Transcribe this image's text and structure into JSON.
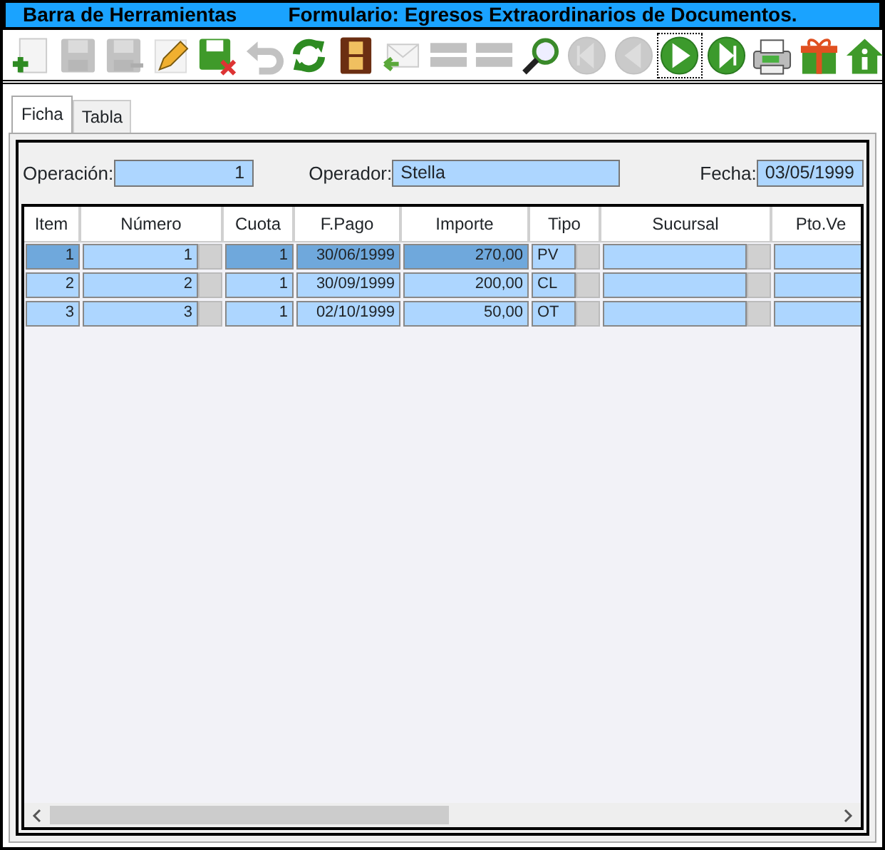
{
  "title_bar": {
    "left": "Barra de Herramientas",
    "right": "Formulario: Egresos Extraordinarios de Documentos."
  },
  "toolbar": [
    {
      "kind": "new",
      "disabled": false,
      "focused": false
    },
    {
      "kind": "save",
      "disabled": true,
      "focused": false
    },
    {
      "kind": "saveas",
      "disabled": true,
      "focused": false
    },
    {
      "kind": "edit",
      "disabled": false,
      "focused": false
    },
    {
      "kind": "cancel",
      "disabled": false,
      "focused": false
    },
    {
      "kind": "undo",
      "disabled": true,
      "focused": false
    },
    {
      "kind": "refresh",
      "disabled": false,
      "focused": false
    },
    {
      "kind": "film",
      "disabled": false,
      "focused": false
    },
    {
      "kind": "mail",
      "disabled": false,
      "focused": false
    },
    {
      "kind": "listadd",
      "disabled": true,
      "focused": false
    },
    {
      "kind": "list",
      "disabled": true,
      "focused": false
    },
    {
      "kind": "search",
      "disabled": false,
      "focused": false
    },
    {
      "kind": "first",
      "disabled": true,
      "focused": false
    },
    {
      "kind": "prev",
      "disabled": true,
      "focused": false
    },
    {
      "kind": "play",
      "disabled": false,
      "focused": true
    },
    {
      "kind": "last",
      "disabled": false,
      "focused": false
    },
    {
      "kind": "printer",
      "disabled": false,
      "focused": false
    },
    {
      "kind": "gift",
      "disabled": false,
      "focused": false
    },
    {
      "kind": "home",
      "disabled": false,
      "focused": false
    }
  ],
  "tabs": [
    {
      "label": "Ficha",
      "selected": true
    },
    {
      "label": "Tabla",
      "selected": false
    }
  ],
  "form": {
    "operacion_label": "Operación:",
    "operacion": "1",
    "operador_label": "Operador:",
    "operador": "Stella",
    "fecha_label": "Fecha:",
    "fecha": "03/05/1999"
  },
  "table": {
    "columns": [
      {
        "label": "Item",
        "kind": "num"
      },
      {
        "label": "Número",
        "kind": "combo"
      },
      {
        "label": "Cuota",
        "kind": "num"
      },
      {
        "label": "F.Pago",
        "kind": "num"
      },
      {
        "label": "Importe",
        "kind": "num"
      },
      {
        "label": "Tipo",
        "kind": "combotext"
      },
      {
        "label": "Sucursal",
        "kind": "combo"
      },
      {
        "label": "Pto.Ve",
        "kind": "text"
      }
    ],
    "rows": [
      {
        "selected": true,
        "cells": [
          "1",
          "1",
          "1",
          "30/06/1999",
          "270,00",
          "PV"
        ]
      },
      {
        "selected": false,
        "cells": [
          "2",
          "2",
          "1",
          "30/09/1999",
          "200,00",
          "CL"
        ]
      },
      {
        "selected": false,
        "cells": [
          "3",
          "3",
          "1",
          "02/10/1999",
          "50,00",
          "OT"
        ]
      }
    ]
  }
}
